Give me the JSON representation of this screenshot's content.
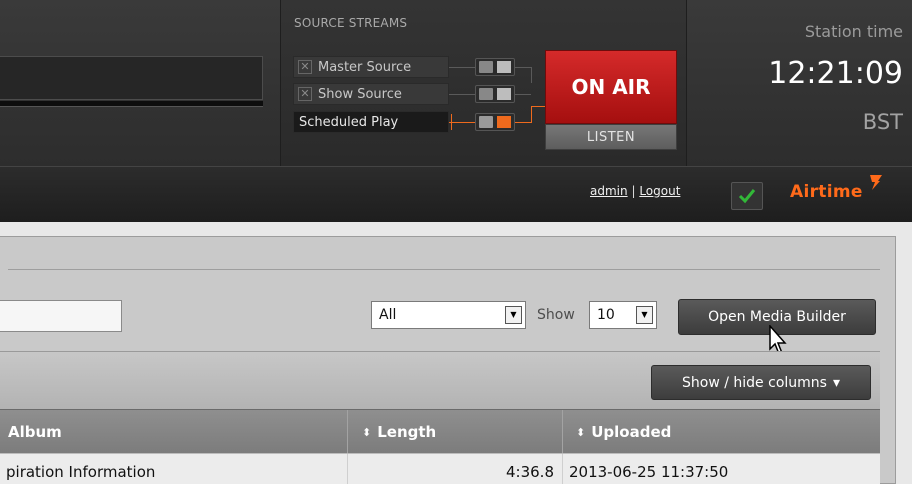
{
  "source_streams": {
    "title": "SOURCE STREAMS",
    "sources": [
      {
        "label": "Master Source",
        "state": "off"
      },
      {
        "label": "Show Source",
        "state": "off"
      },
      {
        "label": "Scheduled Play",
        "state": "on"
      }
    ],
    "on_air_label": "ON AIR",
    "listen_label": "LISTEN"
  },
  "station": {
    "label": "Station time",
    "time": "12:21:09",
    "timezone": "BST"
  },
  "nav": {
    "user": "admin",
    "separator": "|",
    "logout": "Logout",
    "logo": "Airtime"
  },
  "library": {
    "filter_value": "All",
    "show_label": "Show",
    "show_value": "10",
    "open_builder_label": "Open Media Builder",
    "columns_button_label": "Show / hide columns",
    "columns": [
      "Album",
      "Length",
      "Uploaded"
    ],
    "rows": [
      {
        "album": "piration Information",
        "length": "4:36.8",
        "uploaded": "2013-06-25 11:37:50"
      }
    ]
  },
  "colors": {
    "accent": "#ef6a1d",
    "on_air": "#c01c1c",
    "status_ok": "#32b838"
  }
}
